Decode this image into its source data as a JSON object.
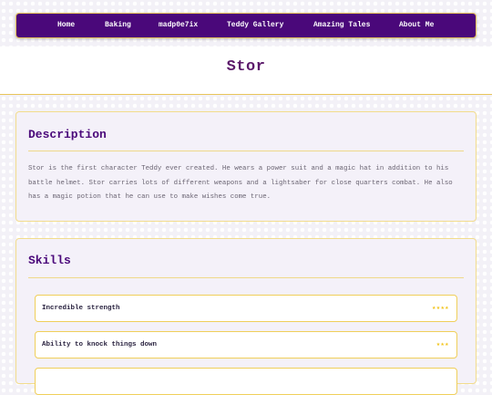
{
  "nav": {
    "items": [
      {
        "label": "Home"
      },
      {
        "label": "Baking"
      },
      {
        "label": "madp0e7ix"
      },
      {
        "label": "Teddy Gallery"
      },
      {
        "label": "Amazing Tales"
      },
      {
        "label": "About Me"
      }
    ]
  },
  "page": {
    "title": "Stor"
  },
  "description": {
    "heading": "Description",
    "text": "Stor is the first character Teddy ever created. He wears a power suit and a magic hat in addition to his battle helmet. Stor carries lots of different weapons and a lightsaber for close quarters combat. He also has a magic potion that he can use to make wishes come true."
  },
  "skills": {
    "heading": "Skills",
    "items": [
      {
        "label": "Incredible strength",
        "stars": "★★★★",
        "rating": 4
      },
      {
        "label": "Ability to knock things down",
        "stars": "★★★",
        "rating": 3
      }
    ]
  },
  "colors": {
    "nav_background": "#4a087a",
    "accent_gold": "#e8c55a",
    "title": "#5c1a6b",
    "star": "#f2c41c"
  }
}
